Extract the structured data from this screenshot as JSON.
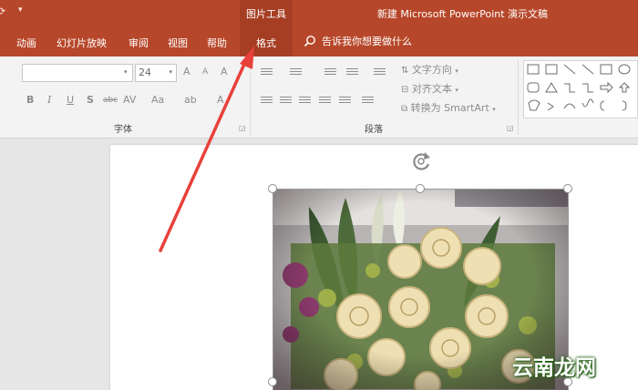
{
  "title_bar": {
    "contextual_title": "图片工具",
    "document_title": "新建 Microsoft PowerPoint 演示文稿"
  },
  "tabs": [
    {
      "label": "动画"
    },
    {
      "label": "幻灯片放映"
    },
    {
      "label": "审阅"
    },
    {
      "label": "视图"
    },
    {
      "label": "帮助"
    },
    {
      "label": "格式",
      "active": true
    }
  ],
  "tell_me": {
    "label": "告诉我你想要做什么"
  },
  "ribbon": {
    "font_group": {
      "label": "字体",
      "font_name": "",
      "font_size": "24",
      "buttons": {
        "grow": "A",
        "shrink": "A",
        "clear": "A",
        "bold": "B",
        "italic": "I",
        "underline": "U",
        "shadow": "S",
        "strike": "abc",
        "spacing": "AV",
        "case": "Aa",
        "highlight": "ab",
        "color": "A"
      }
    },
    "paragraph_group": {
      "label": "段落",
      "text_direction": "文字方向",
      "align_text": "对齐文本",
      "convert_smartart": "转换为 SmartArt"
    }
  },
  "colors": {
    "accent": "#b7472a",
    "accent_dark": "#a63e23",
    "ribbon_bg": "#f3f3f3",
    "canvas_bg": "#e6e6e6",
    "arrow": "#e8413b"
  },
  "watermark": {
    "text": "云南龙网"
  }
}
